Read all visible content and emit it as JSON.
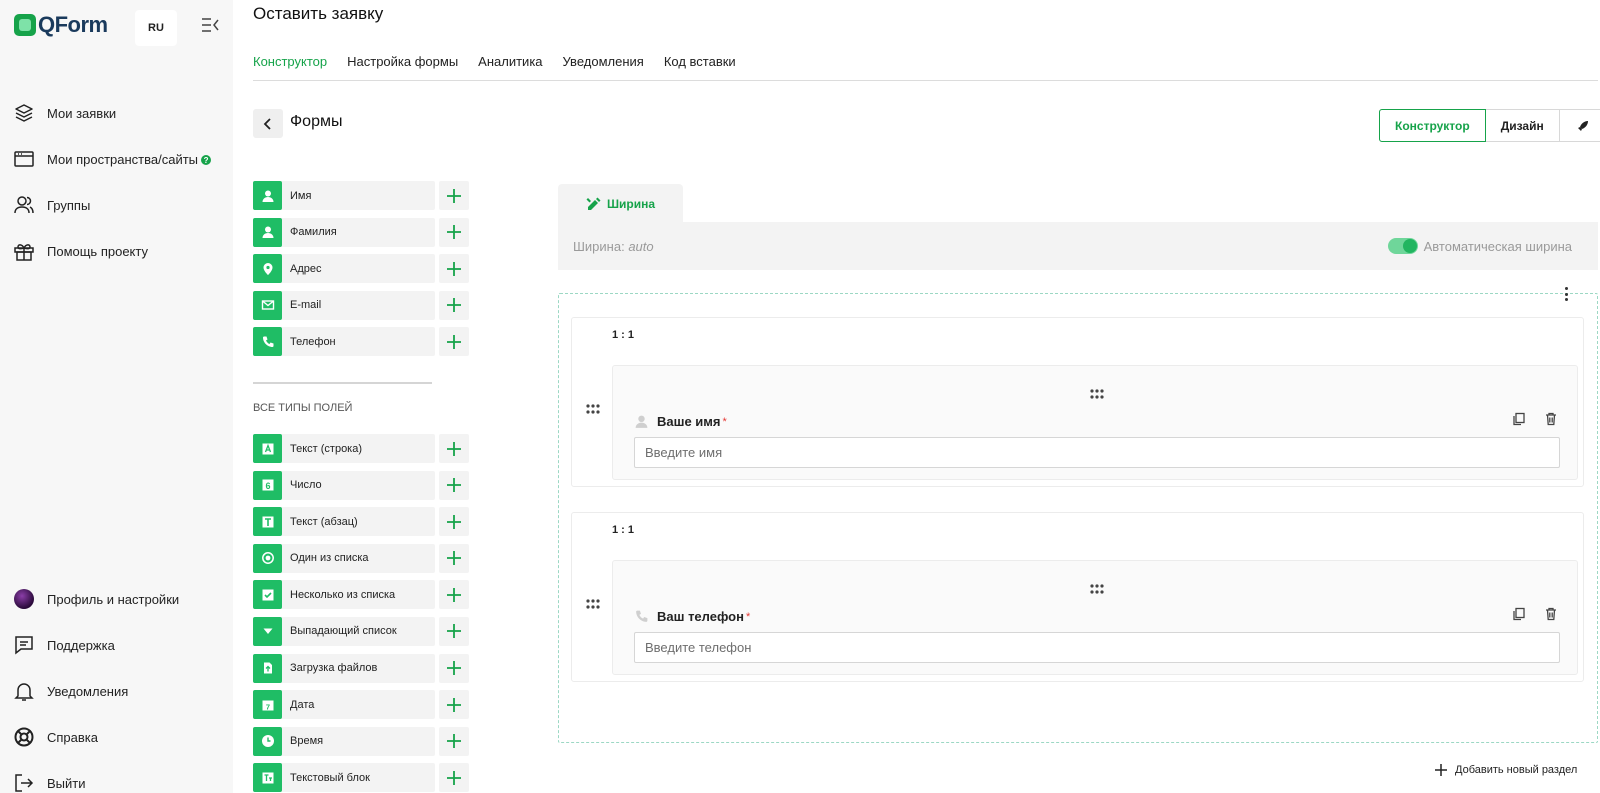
{
  "app": {
    "logo_text": "QForm",
    "lang": "RU"
  },
  "sidebar": {
    "top_items": [
      {
        "label": "Мои заявки",
        "icon": "layers-icon"
      },
      {
        "label": "Мои пространства/сайты",
        "icon": "browser-window-icon",
        "badge": "?"
      },
      {
        "label": "Группы",
        "icon": "users-icon"
      },
      {
        "label": "Помощь проекту",
        "icon": "gift-icon"
      }
    ],
    "bottom_items": [
      {
        "label": "Профиль и настройки",
        "icon": "avatar"
      },
      {
        "label": "Поддержка",
        "icon": "chat-icon"
      },
      {
        "label": "Уведомления",
        "icon": "bell-icon"
      },
      {
        "label": "Справка",
        "icon": "lifebuoy-icon"
      },
      {
        "label": "Выйти",
        "icon": "logout-icon"
      }
    ]
  },
  "header": {
    "title": "Оставить заявку",
    "tabs": [
      {
        "label": "Конструктор",
        "active": true
      },
      {
        "label": "Настройка формы",
        "active": false
      },
      {
        "label": "Аналитика",
        "active": false
      },
      {
        "label": "Уведомления",
        "active": false
      },
      {
        "label": "Код вставки",
        "active": false
      }
    ]
  },
  "builder": {
    "title": "Формы",
    "modes": [
      "Конструктор",
      "Дизайн"
    ],
    "active_mode": "Конструктор"
  },
  "palette": {
    "quick_fields": [
      {
        "label": "Имя",
        "icon": "user-icon"
      },
      {
        "label": "Фамилия",
        "icon": "user-icon"
      },
      {
        "label": "Адрес",
        "icon": "location-pin-icon"
      },
      {
        "label": "E-mail",
        "icon": "envelope-icon"
      },
      {
        "label": "Телефон",
        "icon": "phone-icon"
      }
    ],
    "all_types_title": "ВСЕ ТИПЫ ПОЛЕЙ",
    "all_types": [
      {
        "label": "Текст (строка)",
        "icon": "text-line-icon"
      },
      {
        "label": "Число",
        "icon": "number-icon"
      },
      {
        "label": "Текст (абзац)",
        "icon": "text-paragraph-icon"
      },
      {
        "label": "Один из списка",
        "icon": "radio-icon"
      },
      {
        "label": "Несколько из списка",
        "icon": "checkbox-icon"
      },
      {
        "label": "Выпадающий список",
        "icon": "dropdown-icon"
      },
      {
        "label": "Загрузка файлов",
        "icon": "file-upload-icon"
      },
      {
        "label": "Дата",
        "icon": "calendar-icon"
      },
      {
        "label": "Время",
        "icon": "clock-icon"
      },
      {
        "label": "Текстовый блок",
        "icon": "text-block-icon"
      }
    ]
  },
  "width_panel": {
    "tab_label": "Ширина",
    "width_prefix": "Ширина:",
    "width_value": "auto",
    "auto_label": "Автоматическая ширина",
    "auto_enabled": true
  },
  "sections": [
    {
      "ratio": "1 : 1",
      "field": {
        "label": "Ваше имя",
        "required": "*",
        "placeholder": "Введите имя",
        "icon": "user-icon"
      }
    },
    {
      "ratio": "1 : 1",
      "field": {
        "label": "Ваш телефон",
        "required": "*",
        "placeholder": "Введите телефон",
        "icon": "phone-icon"
      }
    }
  ],
  "add_section_label": "Добавить новый раздел",
  "colors": {
    "accent": "#16a34a",
    "field_icon_bg": "#1fbd65",
    "required": "#e53935"
  }
}
